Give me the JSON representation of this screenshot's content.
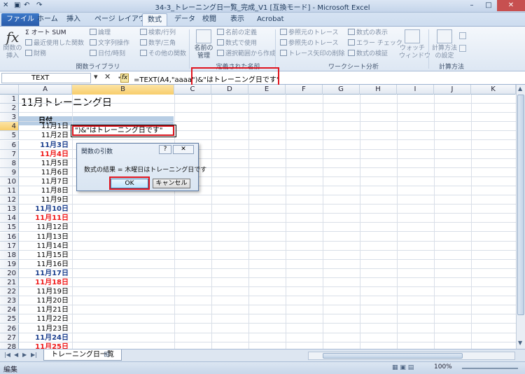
{
  "window": {
    "title": "34-3_トレーニング日一覧_完成_V1 [互換モード] - Microsoft Excel",
    "min": "–",
    "max": "□",
    "close": "✕"
  },
  "tabs": [
    "ファイル",
    "ホーム",
    "挿入",
    "ページ レイアウト",
    "数式",
    "データ",
    "校閲",
    "表示",
    "Acrobat"
  ],
  "ribbon": {
    "insert_function": "関数の\n挿入",
    "autosum": "オート SUM",
    "recent": "最近使用した関数",
    "financial": "財務",
    "logical": "論理",
    "text": "文字列操作",
    "datetime": "日付/時刻",
    "lookup": "検索/行列",
    "math": "数学/三角",
    "more": "その他の関数",
    "group_library": "関数ライブラリ",
    "name_manager": "名前の\n管理",
    "define_name": "名前の定義",
    "use_in_formula": "数式で使用",
    "create_from_selection": "選択範囲から作成",
    "group_names": "定義された名前",
    "trace_precedents": "参照元のトレース",
    "trace_dependents": "参照先のトレース",
    "remove_arrows": "トレース矢印の削除",
    "show_formulas": "数式の表示",
    "error_check": "エラー チェック",
    "evaluate": "数式の検証",
    "group_audit": "ワークシート分析",
    "watch_window": "ウォッチ\nウィンドウ",
    "calc_options": "計算方法\nの設定",
    "group_calc": "計算方法"
  },
  "formula_bar": {
    "name_box": "TEXT",
    "icons": "▾ ✕ ✓",
    "fx": "fx",
    "formula": "=TEXT(A4,\"aaaa\")&\"はトレーニング日です\""
  },
  "columns": [
    "A",
    "B",
    "C",
    "D",
    "E",
    "F",
    "G",
    "H",
    "I",
    "J",
    "K"
  ],
  "rows": [
    "1",
    "2",
    "3",
    "4",
    "5",
    "6",
    "7",
    "8",
    "9",
    "10",
    "11",
    "12",
    "13",
    "14",
    "15",
    "16",
    "17",
    "18",
    "19",
    "20",
    "21",
    "22",
    "23",
    "24",
    "25",
    "26",
    "27",
    "28"
  ],
  "sheet": {
    "title": "11月トレーニング日",
    "header": "日付",
    "editing": "\")&\"はトレーニング日です\"",
    "dates": [
      {
        "text": "11月1日",
        "style": "normal"
      },
      {
        "text": "11月2日",
        "style": "normal"
      },
      {
        "text": "11月3日",
        "style": "blue"
      },
      {
        "text": "11月4日",
        "style": "red"
      },
      {
        "text": "11月5日",
        "style": "normal"
      },
      {
        "text": "11月6日",
        "style": "normal"
      },
      {
        "text": "11月7日",
        "style": "normal"
      },
      {
        "text": "11月8日",
        "style": "normal"
      },
      {
        "text": "11月9日",
        "style": "normal"
      },
      {
        "text": "11月10日",
        "style": "blue"
      },
      {
        "text": "11月11日",
        "style": "red"
      },
      {
        "text": "11月12日",
        "style": "normal"
      },
      {
        "text": "11月13日",
        "style": "normal"
      },
      {
        "text": "11月14日",
        "style": "normal"
      },
      {
        "text": "11月15日",
        "style": "normal"
      },
      {
        "text": "11月16日",
        "style": "normal"
      },
      {
        "text": "11月17日",
        "style": "blue"
      },
      {
        "text": "11月18日",
        "style": "red"
      },
      {
        "text": "11月19日",
        "style": "normal"
      },
      {
        "text": "11月20日",
        "style": "normal"
      },
      {
        "text": "11月21日",
        "style": "normal"
      },
      {
        "text": "11月22日",
        "style": "normal"
      },
      {
        "text": "11月23日",
        "style": "normal"
      },
      {
        "text": "11月24日",
        "style": "blue"
      },
      {
        "text": "11月25日",
        "style": "red"
      }
    ]
  },
  "dialog": {
    "title": "関数の引数",
    "help": "?",
    "close": "✕",
    "result": "数式の結果 =  木曜日はトレーニング日です",
    "ok": "OK",
    "cancel": "キャンセル"
  },
  "sheet_tab": "トレーニング日一覧",
  "status": {
    "mode": "編集",
    "zoom": "100%"
  },
  "colors": {
    "accent_red": "#e0141e",
    "blue_date": "#1b3f8e",
    "red_date": "#f01818"
  }
}
